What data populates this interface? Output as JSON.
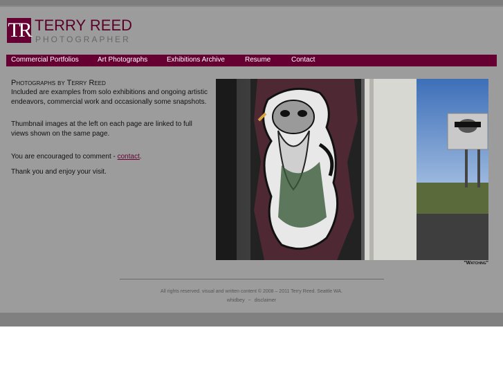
{
  "brand": {
    "mark": "TR",
    "name": "TERRY REED",
    "tagline": "PHOTOGRAPHER",
    "color": "#660033"
  },
  "nav": {
    "items": [
      {
        "label": "Commercial Portfolios"
      },
      {
        "label": "Art Photographs"
      },
      {
        "label": "Exhibitions Archive"
      },
      {
        "label": "Resume"
      },
      {
        "label": "Contact"
      }
    ]
  },
  "intro": {
    "heading": "Photographs by Terry Reed",
    "para1": "Included are examples from solo exhibitions and ongoing artistic endeavors, commercial work and occasionally some snapshots.",
    "para2": "Thumbnail images at the left on each page are linked to full views shown on the same page.",
    "para3_prefix": "You are encouraged to comment - ",
    "para3_link": "contact",
    "para3_suffix": ".",
    "para4": "Thank you and enjoy your visit."
  },
  "photo": {
    "caption": "\"Watching\""
  },
  "footer": {
    "copyright": "All rights reserved. visual and written content © 2008 – 2011 Terry Reed. Seattle WA.",
    "link1": "whidbey",
    "separator": "~",
    "link2": "disclaimer"
  }
}
